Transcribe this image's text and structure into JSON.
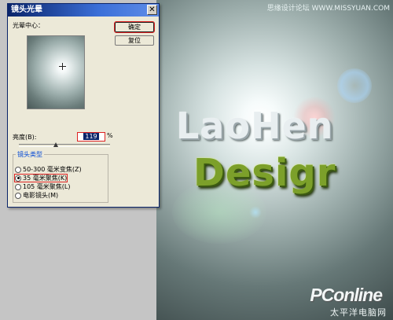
{
  "dialog": {
    "title": "镜头光晕",
    "close_label": "✕",
    "flare_center_label": "光晕中心：",
    "ok_label": "确定",
    "reset_label": "复位",
    "brightness_label": "亮度(B):",
    "brightness_value": "119",
    "brightness_unit": "%",
    "brightness_level_pct": 119,
    "lens_type_label": "镜头类型",
    "lens_options": [
      {
        "label": "50-300 毫米变焦(Z)",
        "selected": false
      },
      {
        "label": "35 毫米聚焦(K)",
        "selected": true
      },
      {
        "label": "105 毫米聚焦(L)",
        "selected": false
      },
      {
        "label": "电影镜头(M)",
        "selected": false
      }
    ]
  },
  "canvas": {
    "watermark_top": "思缘设计论坛 WWW.MISSYUAN.COM",
    "title_line1": "LaoHen",
    "title_line2": "Desigr",
    "brand": "PConline",
    "brand_sub": "太平洋电脑网"
  },
  "colors": {
    "titlebar": "#0a246a",
    "dialog_bg": "#ece9d8",
    "highlight": "#dd2222",
    "text_green": "#7ca02a"
  }
}
